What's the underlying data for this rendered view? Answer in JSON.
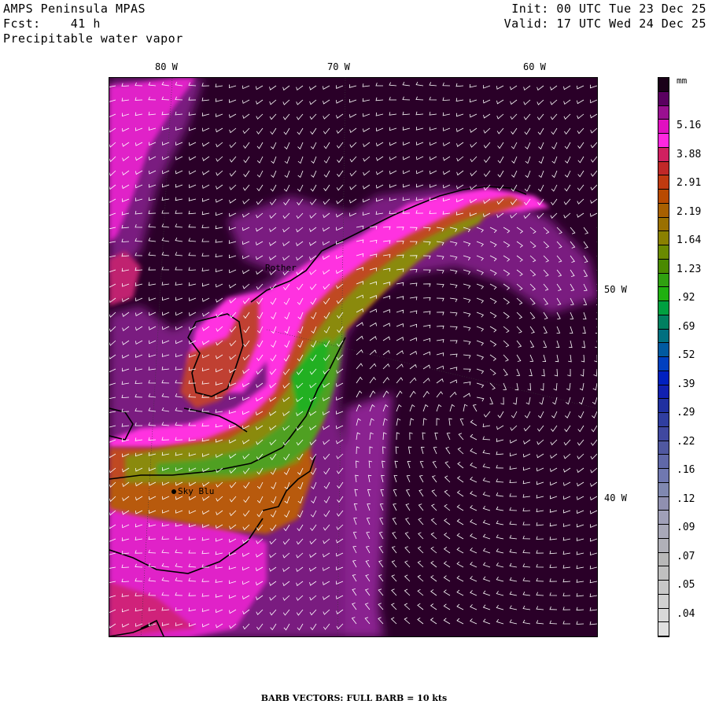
{
  "header": {
    "model": "AMPS Peninsula MPAS",
    "forecast": "Fcst:    41 h",
    "field": "Precipitable water vapor",
    "init": "Init: 00 UTC Tue 23 Dec 25",
    "valid": "Valid: 17 UTC Wed 24 Dec 25"
  },
  "lon_labels": [
    "80 W",
    "70 W",
    "60 W"
  ],
  "lat_labels": [
    "50 W",
    "40 W"
  ],
  "stations": [
    "Rother",
    "Sky Blu"
  ],
  "legend": {
    "unit": "mm",
    "labels": [
      "5.16",
      "3.88",
      "2.91",
      "2.19",
      "1.64",
      "1.23",
      ".92",
      ".69",
      ".52",
      ".39",
      ".29",
      ".22",
      ".16",
      ".12",
      ".09",
      ".07",
      ".05",
      ".04"
    ],
    "colors": [
      "#1a0018",
      "#5a0060",
      "#9a1090",
      "#e010c0",
      "#ff28e0",
      "#d02060",
      "#c02828",
      "#c03a10",
      "#b84a00",
      "#a86000",
      "#9a7000",
      "#8a8000",
      "#6a8a00",
      "#4a8a00",
      "#30a010",
      "#20b010",
      "#00a040",
      "#008060",
      "#007080",
      "#005aa0",
      "#0040c0",
      "#0020c0",
      "#1020b0",
      "#2030a0",
      "#303ea0",
      "#4048a0",
      "#5058a0",
      "#6068a8",
      "#7078b0",
      "#8088b0",
      "#9090b0",
      "#a0a0b8",
      "#a8a8b8",
      "#b0b0b8",
      "#b8b8b8",
      "#c0c0c0",
      "#c8c8c8",
      "#d0d0d0",
      "#d8d8d8",
      "#e0e0e0"
    ]
  },
  "footer": "BARB VECTORS:  FULL BARB = 10 kts"
}
